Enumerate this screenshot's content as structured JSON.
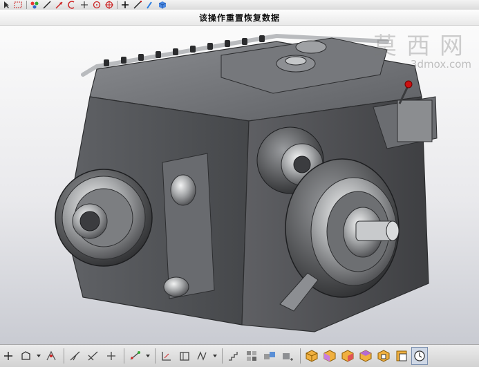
{
  "status": {
    "message": "该操作重置恢复数据"
  },
  "watermark": {
    "logo_text": "莫西网",
    "url_text": "3dmox.com"
  },
  "top_toolbar": {
    "icons": [
      "select-icon",
      "marquee-icon",
      "color-icon",
      "line-icon",
      "line-arrow-icon",
      "arc-icon",
      "point-icon",
      "circle-point-icon",
      "target-icon",
      "add-icon",
      "edit-line-icon",
      "cursor-icon",
      "cube-icon"
    ]
  },
  "bottom_toolbar": {
    "groups": [
      [
        "plus-icon",
        "sketch-icon",
        "sketch-dropdown-icon",
        "trim-icon"
      ],
      [
        "angle-icon",
        "angle-alt-icon",
        "axis-icon"
      ],
      [
        "constraint-icon",
        "constraint-dropdown-icon"
      ],
      [
        "align-icon",
        "frame-icon",
        "profile-icon",
        "profile-dropdown-icon"
      ],
      [
        "stair-icon",
        "pattern-icon",
        "transform-icon",
        "move-icon"
      ],
      [
        "view-iso-icon",
        "view-front-icon",
        "view-top-icon",
        "view-side-icon",
        "view-back-icon",
        "view-fit-icon",
        "clock-icon"
      ]
    ]
  },
  "colors": {
    "accent": "#2a7de1",
    "model_gray": "#5a5b5e",
    "highlight_red": "#cc1111"
  }
}
